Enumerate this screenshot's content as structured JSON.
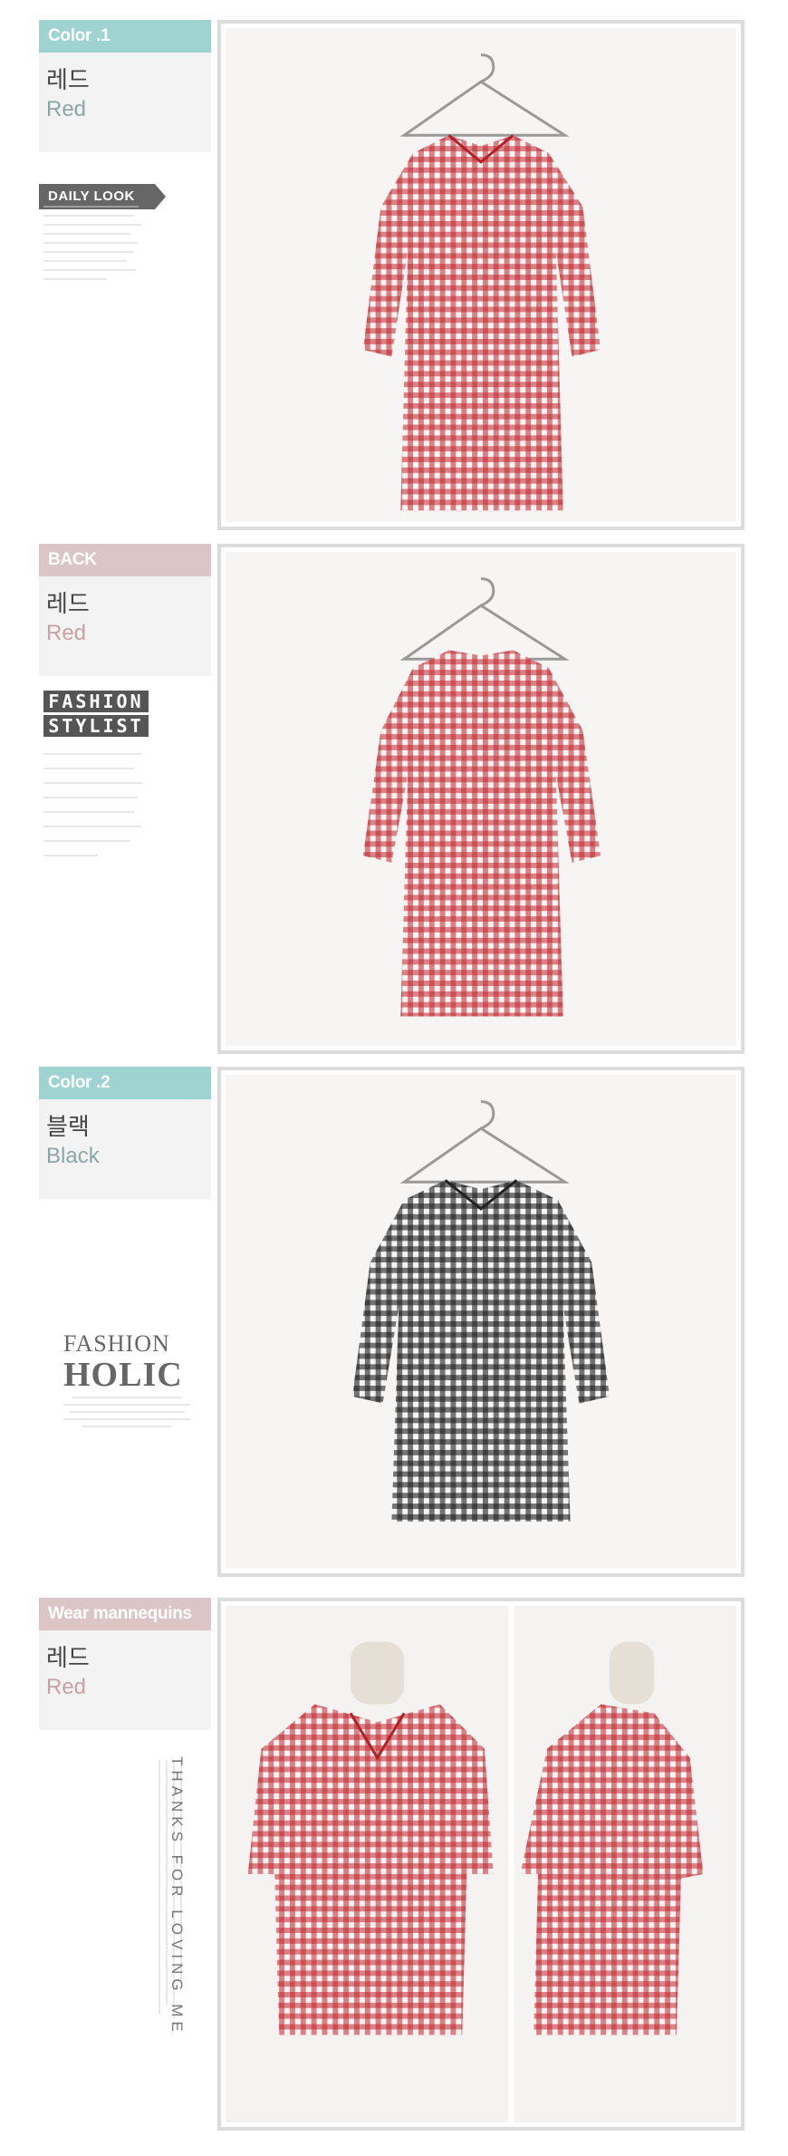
{
  "sections": [
    {
      "tab": "Color .1",
      "kor": "레드",
      "eng": "Red"
    },
    {
      "tab": "BACK",
      "kor": "레드",
      "eng": "Red"
    },
    {
      "tab": "Color .2",
      "kor": "블랙",
      "eng": "Black"
    },
    {
      "tab": "Wear mannequins",
      "kor": "레드",
      "eng": "Red"
    }
  ],
  "badges": {
    "daily_look": "DAILY LOOK",
    "fashion_stylist_line1": "FASHION",
    "fashion_stylist_line2": "STYLIST",
    "fashion_holic_line1": "FASHION",
    "fashion_holic_line2": "HOLIC",
    "thanks": "THANKS FOR LOVING ME"
  },
  "colors": {
    "teal_tab": "#9fd3d2",
    "pink_tab": "#dcc5c6",
    "red_gingham": "#c0242d",
    "black_gingham": "#1e1e1e"
  }
}
